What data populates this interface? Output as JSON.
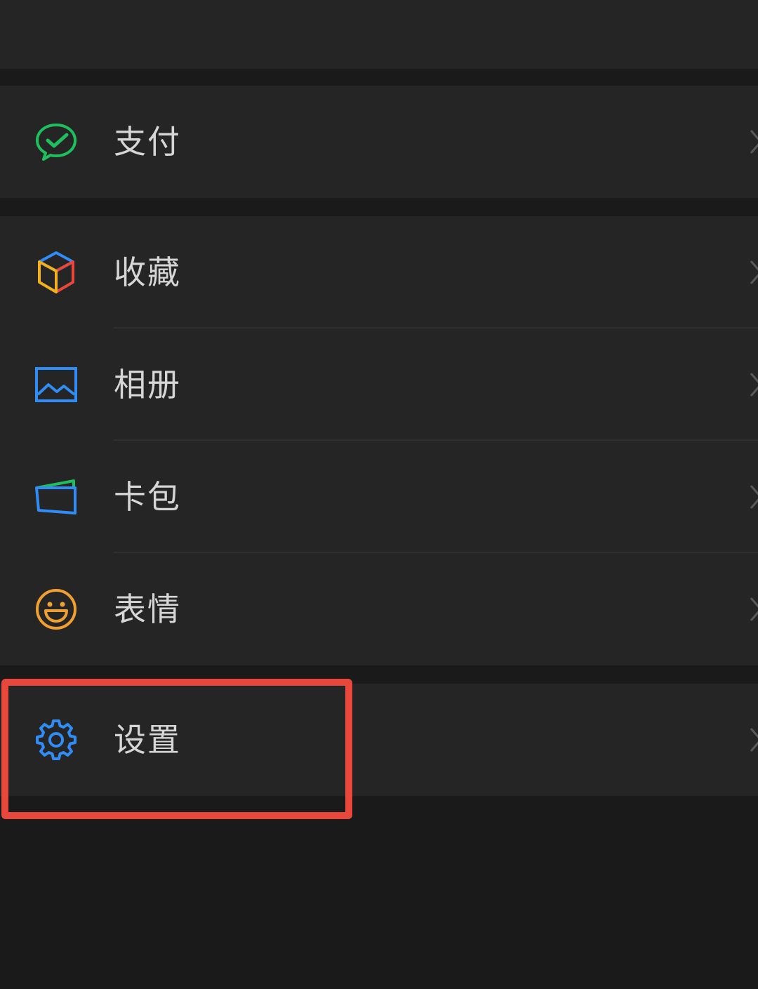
{
  "menu": {
    "pay": {
      "label": "支付",
      "icon": "wechat-pay-icon",
      "color": "#1fbf5e"
    },
    "favorites": {
      "label": "收藏",
      "icon": "cube-icon",
      "colors": [
        "#2f8df5",
        "#e8483b",
        "#f2b01e"
      ]
    },
    "album": {
      "label": "相册",
      "icon": "picture-icon",
      "color": "#2f8df5"
    },
    "cards": {
      "label": "卡包",
      "icon": "wallet-icon",
      "color": "#2f8df5"
    },
    "stickers": {
      "label": "表情",
      "icon": "smiley-icon",
      "color": "#f0a030"
    },
    "settings": {
      "label": "设置",
      "icon": "gear-icon",
      "color": "#2f8df5"
    }
  },
  "highlight": {
    "target": "settings",
    "color": "#e8483b"
  }
}
